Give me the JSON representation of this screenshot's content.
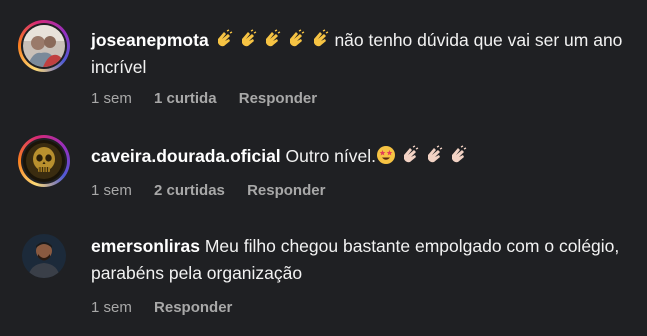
{
  "comments": [
    {
      "username": "joseanepmota",
      "emoji_prefix": "clapping-hands x5",
      "text": "não tenho dúvida que vai ser um ano incrível",
      "time": "1 sem",
      "likes": "1 curtida",
      "reply": "Responder",
      "story_ring": true
    },
    {
      "username": "caveira.dourada.oficial",
      "text": "Outro nível.",
      "emoji_suffix": "star-struck, clapping-hands x3",
      "time": "1 sem",
      "likes": "2 curtidas",
      "reply": "Responder",
      "story_ring": true
    },
    {
      "username": "emersonliras",
      "text": "Meu filho chegou bastante empolgado com o colégio, parabéns pela organização",
      "time": "1 sem",
      "reply": "Responder",
      "story_ring": false
    }
  ],
  "colors": {
    "background": "#1f2023",
    "meta_text": "#a8a8a8",
    "clap_yellow": "#f6c343",
    "clap_pale": "#f2d2c4"
  }
}
